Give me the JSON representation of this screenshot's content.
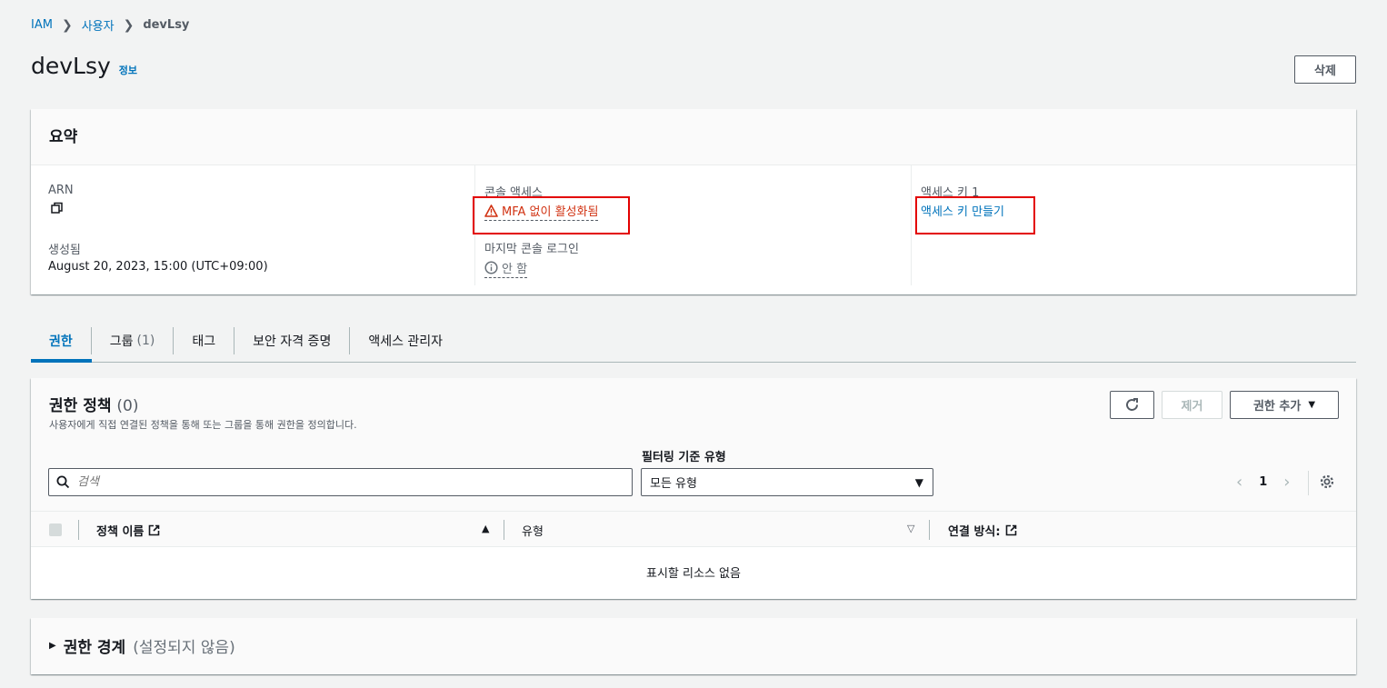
{
  "breadcrumb": {
    "root": "IAM",
    "users": "사용자",
    "current": "devLsy"
  },
  "header": {
    "title": "devLsy",
    "info": "정보",
    "delete_label": "삭제"
  },
  "summary": {
    "title": "요약",
    "arn_label": "ARN",
    "created_label": "생성됨",
    "created_value": "August 20, 2023, 15:00 (UTC+09:00)",
    "console_access_label": "콘솔 액세스",
    "console_access_value": "MFA 없이 활성화됨",
    "last_login_label": "마지막 콘솔 로그인",
    "last_login_value": "안 함",
    "access_key_label": "액세스 키 1",
    "access_key_link": "액세스 키 만들기"
  },
  "tabs": [
    {
      "label": "권한"
    },
    {
      "label": "그룹",
      "count": "(1)"
    },
    {
      "label": "태그"
    },
    {
      "label": "보안 자격 증명"
    },
    {
      "label": "액세스 관리자"
    }
  ],
  "permissions": {
    "title": "권한 정책",
    "count": "(0)",
    "description": "사용자에게 직접 연결된 정책을 통해 또는 그룹을 통해 권한을 정의합니다.",
    "remove_label": "제거",
    "add_label": "권한 추가",
    "filter_label": "필터링 기준 유형",
    "search_placeholder": "검색",
    "filter_value": "모든 유형",
    "page": "1",
    "columns": {
      "name": "정책 이름",
      "type": "유형",
      "attached": "연결 방식:"
    },
    "empty": "표시할 리소스 없음"
  },
  "boundary": {
    "title": "권한 경계",
    "status": "(설정되지 않음)"
  },
  "colors": {
    "link": "#0073bb",
    "warning": "#d13212",
    "highlight_box": "#e30000"
  }
}
